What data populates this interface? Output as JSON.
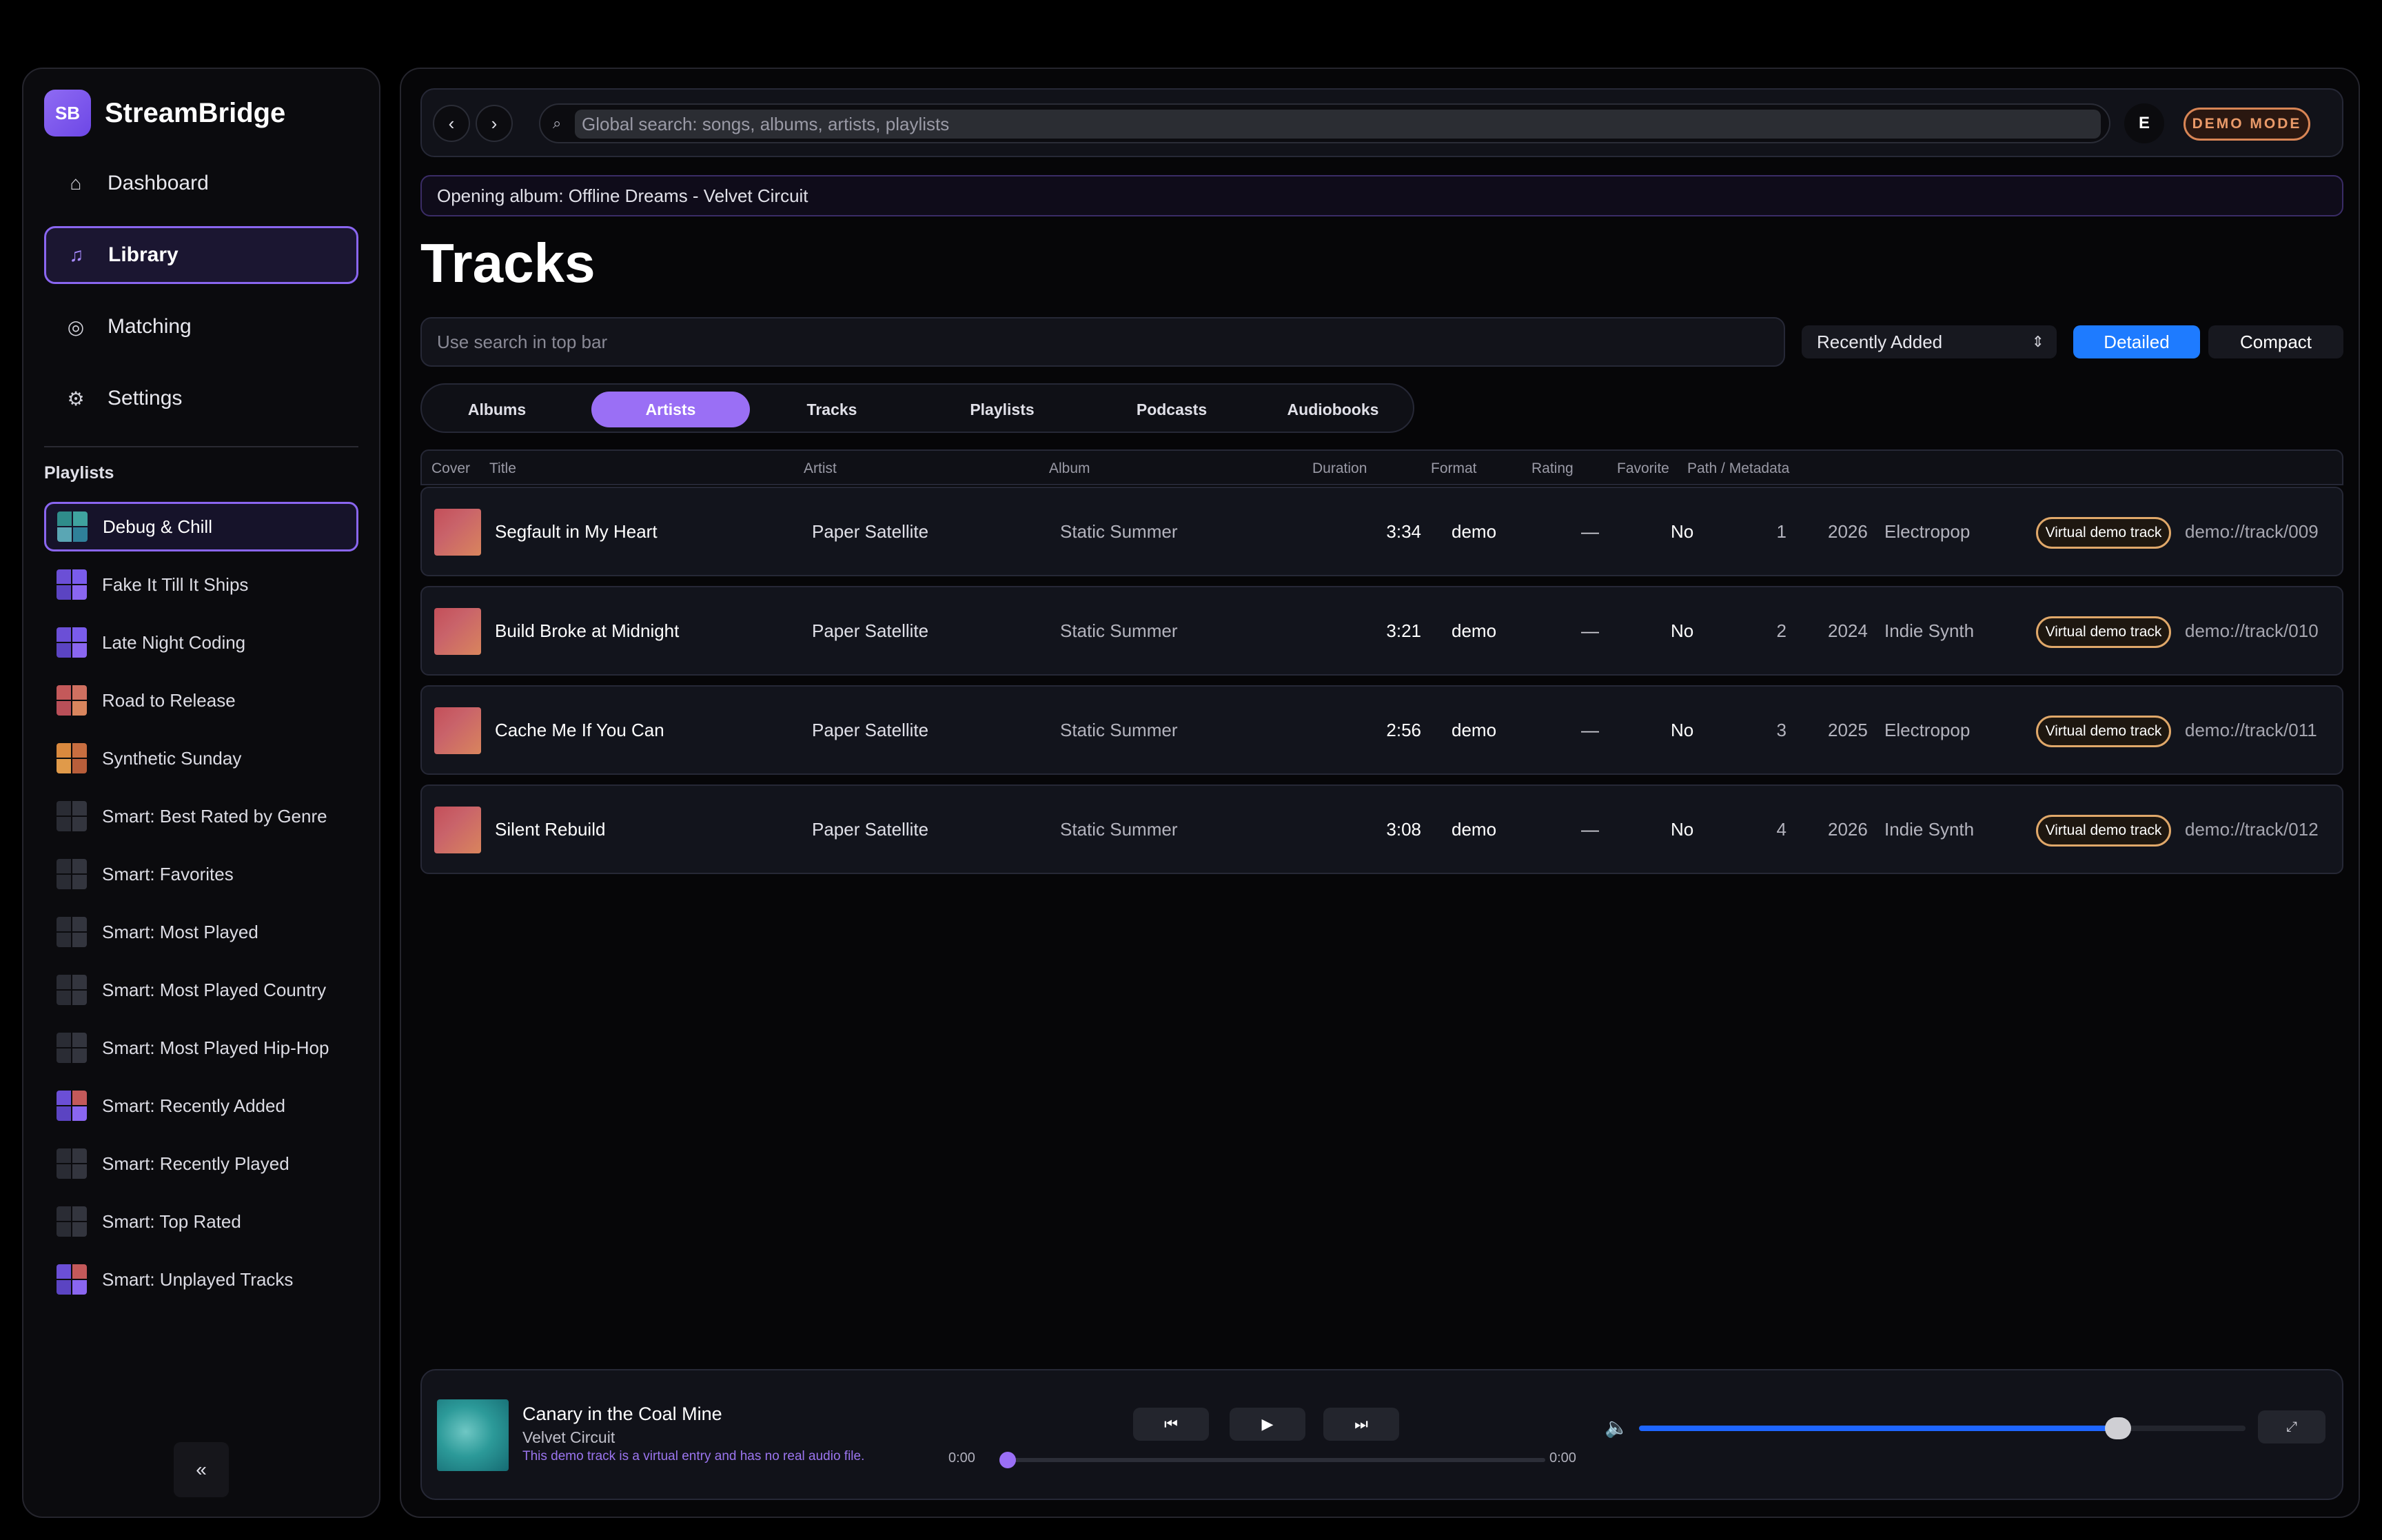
{
  "app": {
    "logo": "SB",
    "name": "StreamBridge"
  },
  "nav": [
    {
      "label": "Dashboard",
      "icon": "home-icon",
      "glyph": "⌂",
      "active": false
    },
    {
      "label": "Library",
      "icon": "music-note-icon",
      "glyph": "♫",
      "active": true
    },
    {
      "label": "Matching",
      "icon": "target-icon",
      "glyph": "◎",
      "active": false
    },
    {
      "label": "Settings",
      "icon": "gear-icon",
      "glyph": "⚙",
      "active": false
    }
  ],
  "playlists": {
    "heading": "Playlists",
    "items": [
      {
        "label": "Debug & Chill",
        "active": true,
        "colors": [
          "#2f8c8a",
          "#3fa39f",
          "#5aa6b4",
          "#2f8099"
        ]
      },
      {
        "label": "Fake It Till It Ships",
        "active": false,
        "colors": [
          "#6b4fd6",
          "#7a5cec",
          "#5b44c2",
          "#8a66f0"
        ]
      },
      {
        "label": "Late Night Coding",
        "active": false,
        "colors": [
          "#6b4fd6",
          "#7a5cec",
          "#5b44c2",
          "#8a66f0"
        ]
      },
      {
        "label": "Road to Release",
        "active": false,
        "colors": [
          "#c4595a",
          "#d07060",
          "#b94f58",
          "#d9855d"
        ]
      },
      {
        "label": "Synthetic Sunday",
        "active": false,
        "colors": [
          "#d9893e",
          "#c86e40",
          "#e09a4a",
          "#b85e3a"
        ]
      },
      {
        "label": "Smart: Best Rated by Genre",
        "active": false,
        "colors": [
          "#2a2c34",
          "#33353e",
          "#2a2c34",
          "#33353e"
        ]
      },
      {
        "label": "Smart: Favorites",
        "active": false,
        "colors": [
          "#2a2c34",
          "#33353e",
          "#2a2c34",
          "#33353e"
        ]
      },
      {
        "label": "Smart: Most Played",
        "active": false,
        "colors": [
          "#2a2c34",
          "#33353e",
          "#2a2c34",
          "#33353e"
        ]
      },
      {
        "label": "Smart: Most Played Country",
        "active": false,
        "colors": [
          "#2a2c34",
          "#33353e",
          "#2a2c34",
          "#33353e"
        ]
      },
      {
        "label": "Smart: Most Played Hip-Hop",
        "active": false,
        "colors": [
          "#2a2c34",
          "#33353e",
          "#2a2c34",
          "#33353e"
        ]
      },
      {
        "label": "Smart: Recently Added",
        "active": false,
        "colors": [
          "#6b4fd6",
          "#c4595a",
          "#5b44c2",
          "#8a66f0"
        ]
      },
      {
        "label": "Smart: Recently Played",
        "active": false,
        "colors": [
          "#2a2c34",
          "#33353e",
          "#2a2c34",
          "#33353e"
        ]
      },
      {
        "label": "Smart: Top Rated",
        "active": false,
        "colors": [
          "#2a2c34",
          "#33353e",
          "#2a2c34",
          "#33353e"
        ]
      },
      {
        "label": "Smart: Unplayed Tracks",
        "active": false,
        "colors": [
          "#6b4fd6",
          "#c4595a",
          "#5b44c2",
          "#8a66f0"
        ]
      }
    ]
  },
  "sidebar_collapse_label": "«",
  "topbar": {
    "back_label": "‹",
    "forward_label": "›",
    "search_icon": "⌕",
    "search_placeholder": "Global search: songs, albums, artists, playlists",
    "avatar": "E",
    "demo_badge": "DEMO MODE"
  },
  "status_message": "Opening album: Offline Dreams - Velvet Circuit",
  "page_title": "Tracks",
  "filter_placeholder": "Use search in top bar",
  "sort": {
    "selected": "Recently Added",
    "chevron": "⌃⌄"
  },
  "view_modes": {
    "detailed": "Detailed",
    "compact": "Compact",
    "active": "Detailed"
  },
  "tabs": [
    {
      "label": "Albums",
      "active": false
    },
    {
      "label": "Artists",
      "active": true
    },
    {
      "label": "Tracks",
      "active": false
    },
    {
      "label": "Playlists",
      "active": false
    },
    {
      "label": "Podcasts",
      "active": false
    },
    {
      "label": "Audiobooks",
      "active": false
    }
  ],
  "table": {
    "columns": {
      "cover": "Cover",
      "title": "Title",
      "artist": "Artist",
      "album": "Album",
      "duration": "Duration",
      "format": "Format",
      "rating": "Rating",
      "favorite": "Favorite",
      "path": "Path / Metadata"
    },
    "rows": [
      {
        "title": "Segfault in My Heart",
        "artist": "Paper Satellite",
        "album": "Static Summer",
        "duration": "3:34",
        "format": "demo",
        "rating": "—",
        "favorite": "No",
        "track_no": "1",
        "year": "2026",
        "genre": "Electropop",
        "badge": "Virtual demo track",
        "path": "demo://track/009"
      },
      {
        "title": "Build Broke at Midnight",
        "artist": "Paper Satellite",
        "album": "Static Summer",
        "duration": "3:21",
        "format": "demo",
        "rating": "—",
        "favorite": "No",
        "track_no": "2",
        "year": "2024",
        "genre": "Indie Synth",
        "badge": "Virtual demo track",
        "path": "demo://track/010"
      },
      {
        "title": "Cache Me If You Can",
        "artist": "Paper Satellite",
        "album": "Static Summer",
        "duration": "2:56",
        "format": "demo",
        "rating": "—",
        "favorite": "No",
        "track_no": "3",
        "year": "2025",
        "genre": "Electropop",
        "badge": "Virtual demo track",
        "path": "demo://track/011"
      },
      {
        "title": "Silent Rebuild",
        "artist": "Paper Satellite",
        "album": "Static Summer",
        "duration": "3:08",
        "format": "demo",
        "rating": "—",
        "favorite": "No",
        "track_no": "4",
        "year": "2026",
        "genre": "Indie Synth",
        "badge": "Virtual demo track",
        "path": "demo://track/012"
      }
    ]
  },
  "player": {
    "title": "Canary in the Coal Mine",
    "artist": "Velvet Circuit",
    "note": "This demo track is a virtual entry and has no real audio file.",
    "prev_label": "⏮",
    "play_label": "▶",
    "next_label": "⏭",
    "elapsed": "0:00",
    "total": "0:00",
    "progress": 0.0,
    "volume_icon": "🔈",
    "volume": 0.79,
    "expand_label": "⤢"
  },
  "colors": {
    "accent_purple": "#9a6ff5",
    "accent_blue": "#1e7bff",
    "demo_orange": "#e99a69"
  }
}
